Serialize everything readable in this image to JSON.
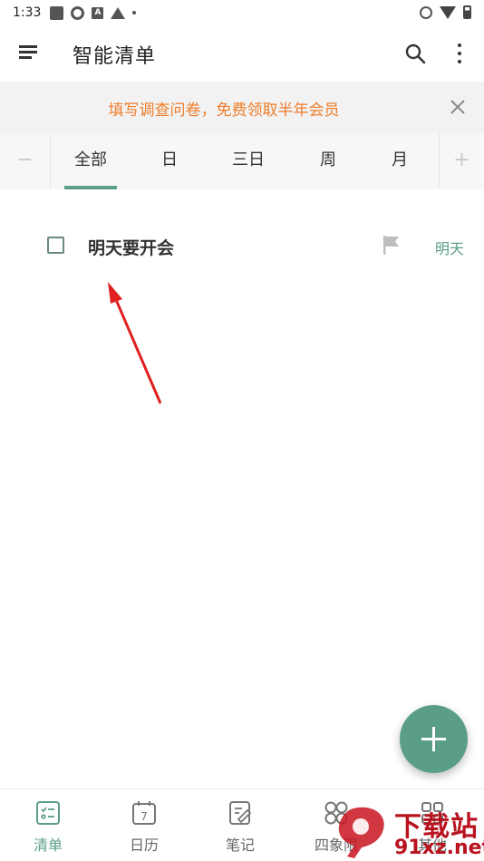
{
  "status_bar": {
    "time": "1:33"
  },
  "toolbar": {
    "title": "智能清单"
  },
  "banner": {
    "text": "填写调查问卷，免费领取半年会员"
  },
  "tabs": {
    "minus": "−",
    "plus": "+",
    "items": [
      {
        "label": "全部",
        "active": true
      },
      {
        "label": "日",
        "active": false
      },
      {
        "label": "三日",
        "active": false
      },
      {
        "label": "周",
        "active": false
      },
      {
        "label": "月",
        "active": false
      }
    ]
  },
  "task": {
    "title": "明天要开会",
    "due": "明天",
    "completed": false
  },
  "bottom_nav": {
    "items": [
      {
        "label": "清单",
        "icon": "checklist-icon",
        "active": true
      },
      {
        "label": "日历",
        "icon": "calendar-icon",
        "calendar_day": "7",
        "active": false
      },
      {
        "label": "笔记",
        "icon": "note-icon",
        "active": false
      },
      {
        "label": "四象限",
        "icon": "quadrant-icon",
        "active": false
      },
      {
        "label": "其他",
        "icon": "more-apps-icon",
        "active": false
      }
    ]
  },
  "watermark": {
    "text": "下载站",
    "url": "91xz.net"
  },
  "colors": {
    "accent": "#5a9e87",
    "banner_text": "#ef7d2a",
    "annotation_arrow": "#e02020"
  }
}
